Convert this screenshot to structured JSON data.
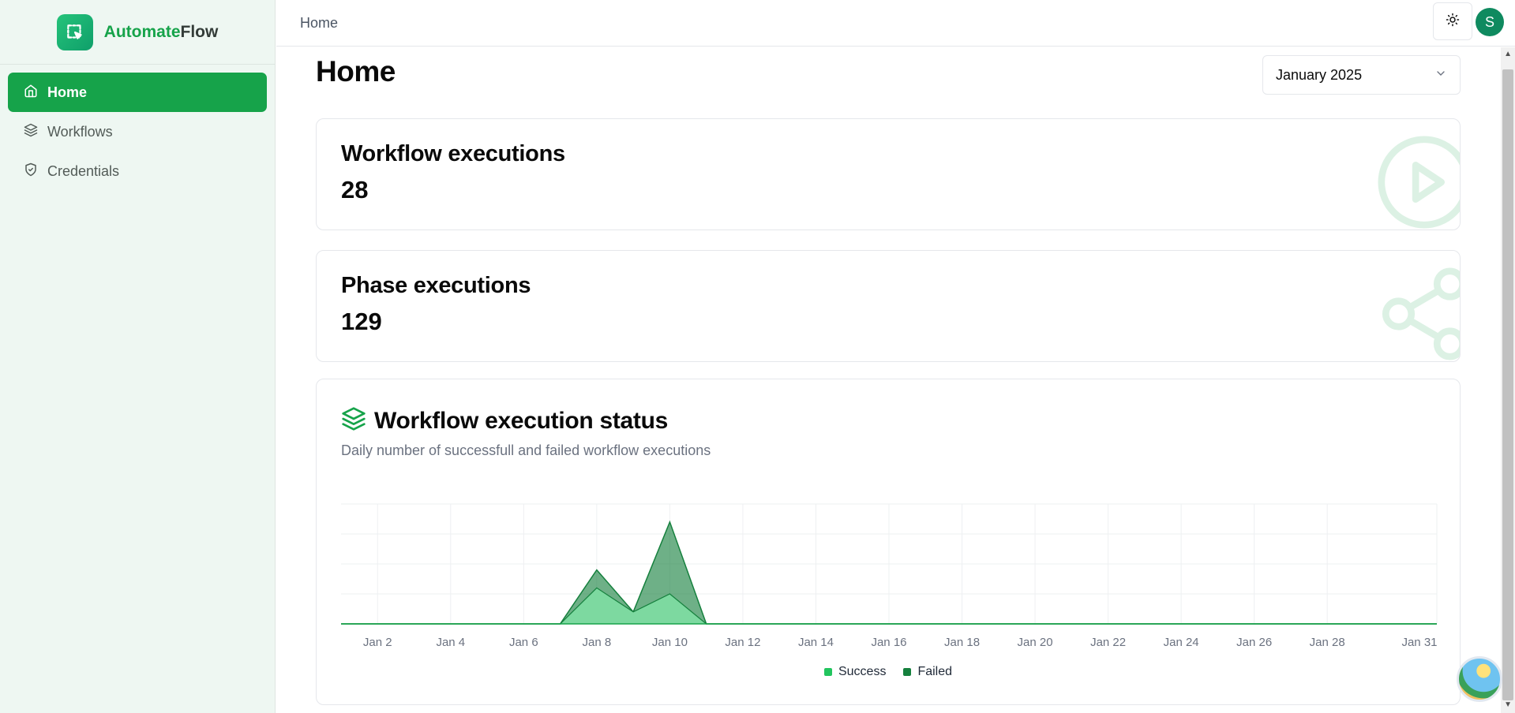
{
  "brand": {
    "name_part1": "Automate",
    "name_part2": "Flow"
  },
  "sidebar": {
    "items": [
      {
        "label": "Home",
        "icon": "home-icon",
        "active": true
      },
      {
        "label": "Workflows",
        "icon": "layers-icon",
        "active": false
      },
      {
        "label": "Credentials",
        "icon": "shield-icon",
        "active": false
      }
    ]
  },
  "header": {
    "breadcrumb": "Home",
    "theme_icon": "sun-icon",
    "avatar_initial": "S"
  },
  "page": {
    "title": "Home",
    "month_select": "January 2025"
  },
  "stats": [
    {
      "title": "Workflow executions",
      "value": "28",
      "icon": "play-circle-icon"
    },
    {
      "title": "Phase executions",
      "value": "129",
      "icon": "waypoints-icon"
    }
  ],
  "chart": {
    "title": "Workflow execution status",
    "subtitle": "Daily number of successfull and failed workflow executions",
    "icon": "layers-icon"
  },
  "colors": {
    "accent": "#16a34a",
    "success": "#22c55e",
    "failed": "#15803d",
    "sidebar_bg": "#eef7f2"
  },
  "chart_data": {
    "type": "area",
    "stacked": true,
    "x": [
      "Jan 1",
      "Jan 2",
      "Jan 3",
      "Jan 4",
      "Jan 5",
      "Jan 6",
      "Jan 7",
      "Jan 8",
      "Jan 9",
      "Jan 10",
      "Jan 11",
      "Jan 12",
      "Jan 13",
      "Jan 14",
      "Jan 15",
      "Jan 16",
      "Jan 17",
      "Jan 18",
      "Jan 19",
      "Jan 20",
      "Jan 21",
      "Jan 22",
      "Jan 23",
      "Jan 24",
      "Jan 25",
      "Jan 26",
      "Jan 27",
      "Jan 28",
      "Jan 29",
      "Jan 30",
      "Jan 31"
    ],
    "tick_labels": [
      "Jan 2",
      "Jan 4",
      "Jan 6",
      "Jan 8",
      "Jan 10",
      "Jan 12",
      "Jan 14",
      "Jan 16",
      "Jan 18",
      "Jan 20",
      "Jan 22",
      "Jan 24",
      "Jan 26",
      "Jan 28",
      "Jan 31"
    ],
    "series": [
      {
        "name": "Success",
        "values": [
          0,
          0,
          0,
          0,
          0,
          0,
          0,
          6,
          2,
          5,
          0,
          0,
          0,
          0,
          0,
          0,
          0,
          0,
          0,
          0,
          0,
          0,
          0,
          0,
          0,
          0,
          0,
          0,
          0,
          0,
          0
        ]
      },
      {
        "name": "Failed",
        "values": [
          0,
          0,
          0,
          0,
          0,
          0,
          0,
          3,
          0,
          12,
          0,
          0,
          0,
          0,
          0,
          0,
          0,
          0,
          0,
          0,
          0,
          0,
          0,
          0,
          0,
          0,
          0,
          0,
          0,
          0,
          0
        ]
      }
    ],
    "ylim": [
      0,
      20
    ],
    "grid": true,
    "legend": "bottom"
  }
}
